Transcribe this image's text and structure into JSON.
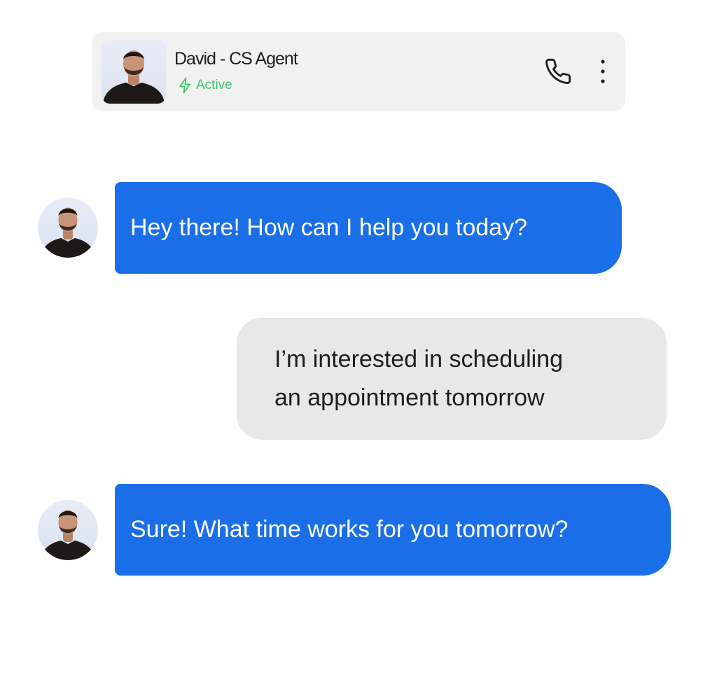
{
  "header": {
    "agent_name": "David - CS Agent",
    "status": "Active",
    "status_color": "#3ec46d",
    "avatar": "agent-portrait",
    "call_icon": "phone-icon",
    "menu_icon": "more-vertical-icon"
  },
  "messages": [
    {
      "sender": "agent",
      "text": "Hey there! How can I help you today?"
    },
    {
      "sender": "user",
      "lines": [
        "I’m interested in scheduling",
        "an appointment tomorrow"
      ]
    },
    {
      "sender": "agent",
      "text": "Sure! What time works for you tomorrow?"
    }
  ],
  "colors": {
    "agent_bubble": "#1a6fe8",
    "user_bubble": "#e8e8e8",
    "header_bg": "#f1f1f1"
  }
}
